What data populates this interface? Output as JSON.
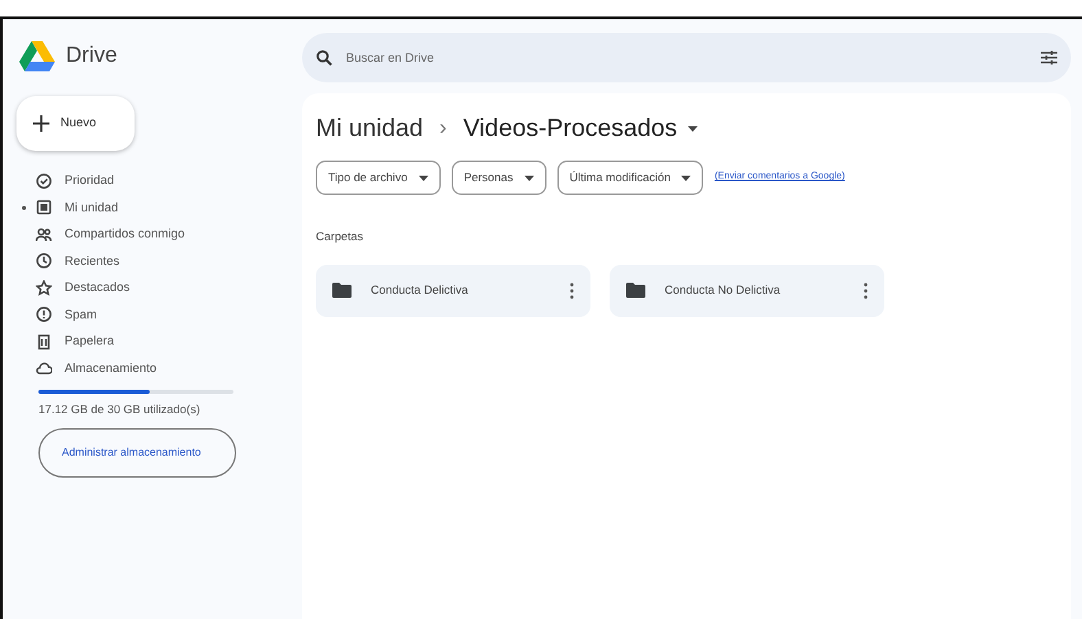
{
  "app": {
    "name": "Drive"
  },
  "new_button": {
    "label": "Nuevo"
  },
  "sidebar": {
    "items": [
      {
        "label": "Prioridad",
        "expandable": false
      },
      {
        "label": "Mi unidad",
        "expandable": true
      },
      {
        "label": "Compartidos conmigo",
        "expandable": false
      },
      {
        "label": "Recientes",
        "expandable": false
      },
      {
        "label": "Destacados",
        "expandable": false
      },
      {
        "label": "Spam",
        "expandable": false
      },
      {
        "label": "Papelera",
        "expandable": false
      },
      {
        "label": "Almacenamiento",
        "expandable": false
      }
    ]
  },
  "storage": {
    "level": 0.57,
    "text": "17.12 GB de 30 GB utilizado(s)",
    "button": "Administrar almacenamiento"
  },
  "search": {
    "placeholder": "Buscar en Drive"
  },
  "breadcrumb": {
    "parent": "Mi unidad",
    "separator": "›",
    "current": "Videos-Procesados"
  },
  "filters": [
    "Tipo de archivo",
    "Personas",
    "Última modificación"
  ],
  "feedback_link": "(Enviar comentarios a Google)",
  "section_title": "Carpetas",
  "folders": [
    {
      "name": "Conducta Delictiva"
    },
    {
      "name": "Conducta No Delictiva"
    }
  ]
}
